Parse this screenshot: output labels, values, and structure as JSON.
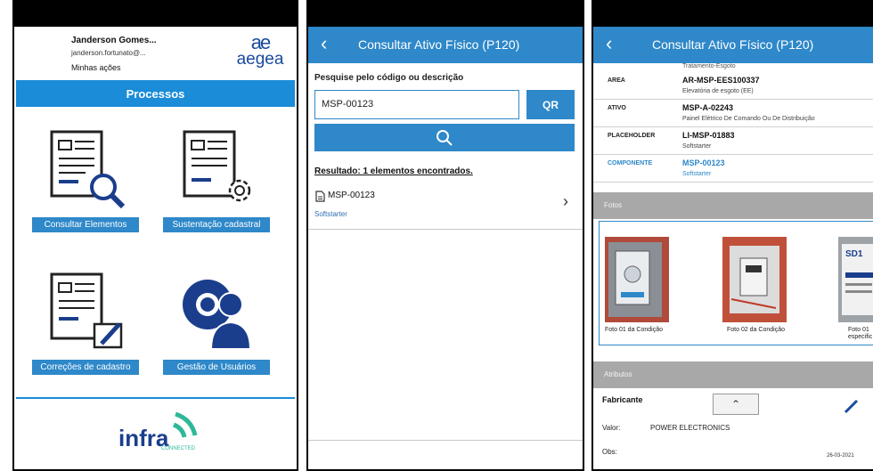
{
  "menu": {
    "user_name": "Janderson Gomes...",
    "user_email": "janderson.fortunato@...",
    "minhas_acoes": "Minhas ações",
    "logo_mark": "ae",
    "logo_text": "aegea",
    "section_title": "Processos",
    "tiles": [
      {
        "label": "Consultar Elementos",
        "icon": "document-search-icon"
      },
      {
        "label": "Sustentação cadastral",
        "icon": "document-gear-icon"
      },
      {
        "label": "Correções de cadastro",
        "icon": "document-edit-icon"
      },
      {
        "label": "Gestão de Usuários",
        "icon": "user-gear-icon"
      }
    ],
    "footer_logo_text": "infra",
    "footer_logo_sub": "CONNECTED"
  },
  "search": {
    "header_title": "Consultar Ativo Físico (P120)",
    "prompt": "Pesquise pelo código ou descrição",
    "input_value": "MSP-00123",
    "qr_label": "QR",
    "result_text": "Resultado: 1 elementos encontrados.",
    "result_item": {
      "code": "MSP-00123",
      "desc": "Softstarter"
    }
  },
  "detail": {
    "header_title": "Consultar Ativo Físico (P120)",
    "top_line": "Tratamento-Esgoto",
    "rows": [
      {
        "key": "AREA",
        "value": "AR-MSP-EES100337",
        "sub": "Elevatória de esgoto (EE)"
      },
      {
        "key": "ATIVO",
        "value": "MSP-A-02243",
        "sub": "Painel Elétrico De Comando Ou De Distribuição"
      },
      {
        "key": "PLACEHOLDER",
        "value": "LI-MSP-01883",
        "sub": "Softstarter"
      },
      {
        "key": "COMPONENTE",
        "value": "MSP-00123",
        "sub": "Softstarter"
      }
    ],
    "fotos_label": "Fotos",
    "photos": [
      {
        "caption": "Foto 01 da Condição"
      },
      {
        "caption": "Foto 02 da Condição"
      },
      {
        "caption": "Foto 01",
        "caption2": "especific",
        "label": "SD1"
      }
    ],
    "atributos_label": "Atributos",
    "fabricante_label": "Fabricante",
    "valor_label": "Valor:",
    "valor_value": "POWER ELECTRONICS",
    "obs_label": "Obs:",
    "date": "26-03-2021"
  },
  "colors": {
    "accent": "#2e88c9",
    "header_bar": "#1a8cd8",
    "section_gray": "#a8a8a8",
    "infra_green": "#2eb89a",
    "infra_blue": "#1a3e8c"
  }
}
